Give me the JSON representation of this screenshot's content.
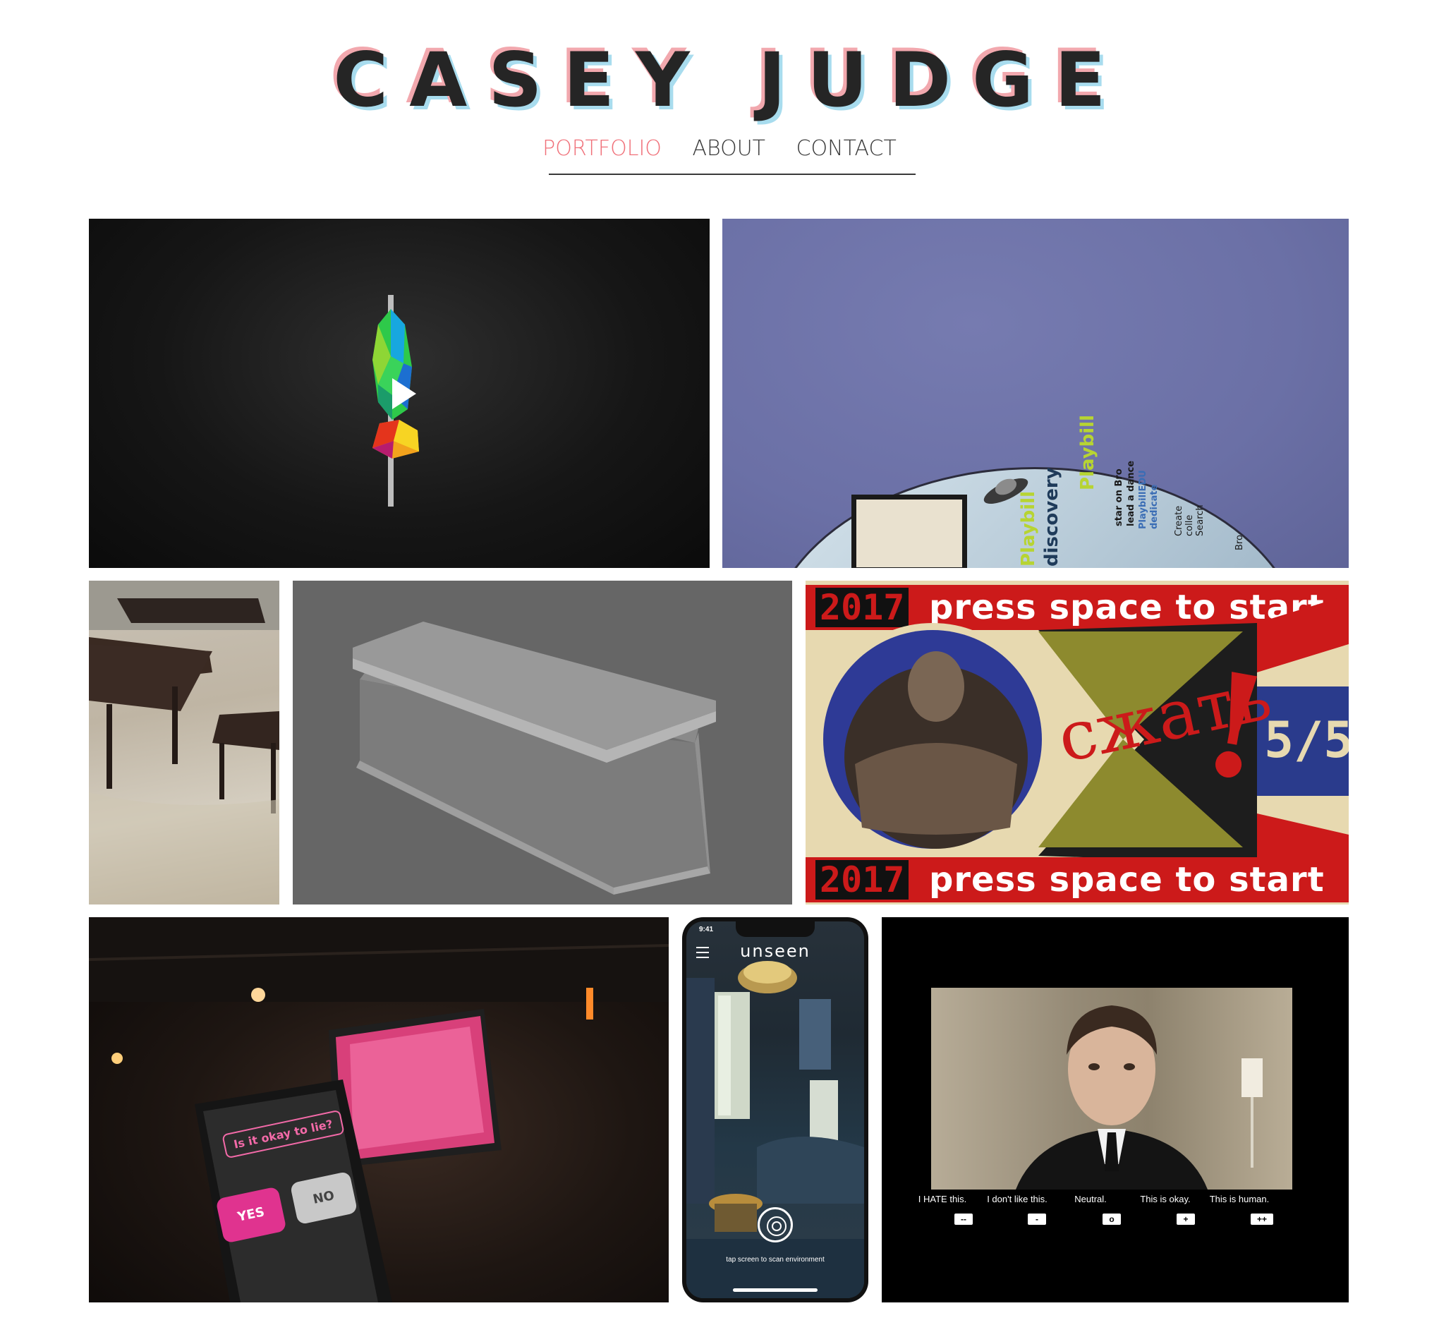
{
  "site": {
    "title": "CASEY JUDGE"
  },
  "nav": {
    "items": [
      "PORTFOLIO",
      "ABOUT",
      "CONTACT"
    ],
    "active": "PORTFOLIO"
  },
  "colors": {
    "accent": "#f07079",
    "title_shadow_pink": "#f2a8ae",
    "title_shadow_blue": "#a8dcee",
    "text": "#252525"
  },
  "portfolio": {
    "tiles": [
      {
        "name": "3d-render-video",
        "has_play_icon": true
      },
      {
        "name": "paper-cutout",
        "visible_text": [
          "Playbill",
          "discovery",
          "star on Bro",
          "lead a dance",
          "PlaybillEDU",
          "dedicate",
          "Create",
          "colle",
          "Search",
          "Bro"
        ]
      },
      {
        "name": "ar-furniture"
      },
      {
        "name": "box-render"
      },
      {
        "name": "press-space-poster",
        "year": "2017",
        "headline": "press space to start",
        "russian": "сжать",
        "exclaim": "!",
        "score": "5/5"
      },
      {
        "name": "event-photo",
        "question": "Is it okay to lie?",
        "yes": "YES",
        "no": "NO"
      },
      {
        "name": "unseen-app",
        "time": "9:41",
        "app_name": "unseen",
        "hint": "tap screen to scan environment"
      },
      {
        "name": "human-survey",
        "ratings": [
          {
            "label": "I HATE this.",
            "button": "--"
          },
          {
            "label": "I don't like this.",
            "button": "-"
          },
          {
            "label": "Neutral.",
            "button": "o"
          },
          {
            "label": "This is okay.",
            "button": "+"
          },
          {
            "label": "This is human.",
            "button": "++"
          }
        ]
      }
    ]
  }
}
